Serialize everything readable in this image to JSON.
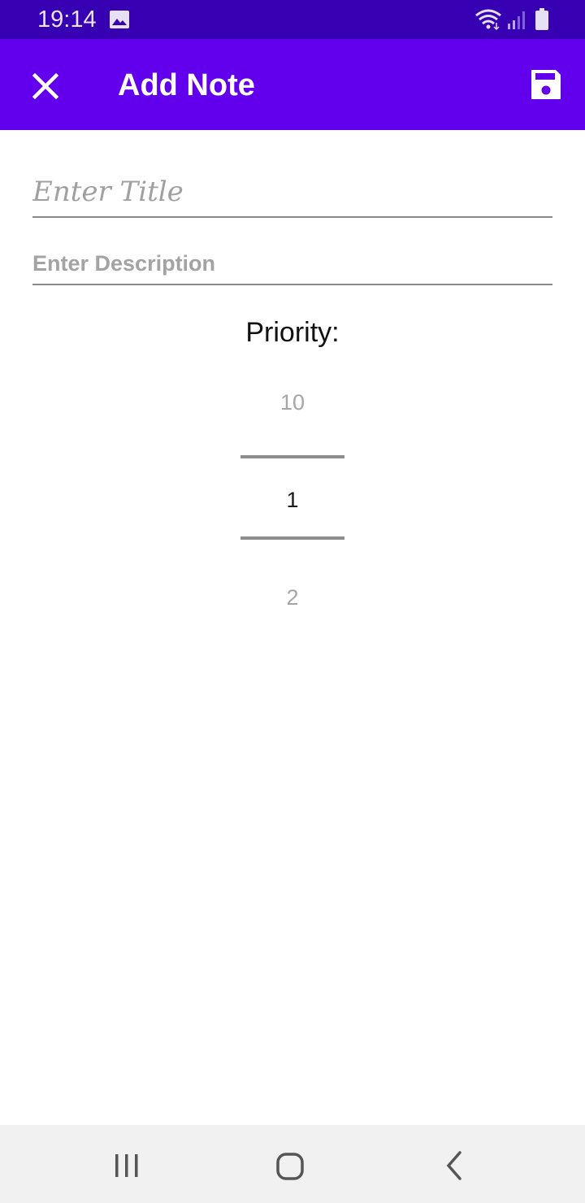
{
  "status_bar": {
    "time": "19:14",
    "icons": [
      "gallery-icon",
      "wifi-icon",
      "signal-icon",
      "battery-icon"
    ],
    "background": "#3700b3"
  },
  "app_bar": {
    "title": "Add Note",
    "close_icon": "close-icon",
    "save_icon": "save-icon",
    "background": "#6200ee"
  },
  "form": {
    "title_placeholder": "Enter Title",
    "title_value": "",
    "description_placeholder": "Enter Description",
    "description_value": ""
  },
  "priority": {
    "label": "Priority:",
    "previous": "10",
    "selected": "1",
    "next": "2"
  },
  "nav_bar": {
    "icons": [
      "recents-icon",
      "home-icon",
      "back-icon"
    ]
  }
}
